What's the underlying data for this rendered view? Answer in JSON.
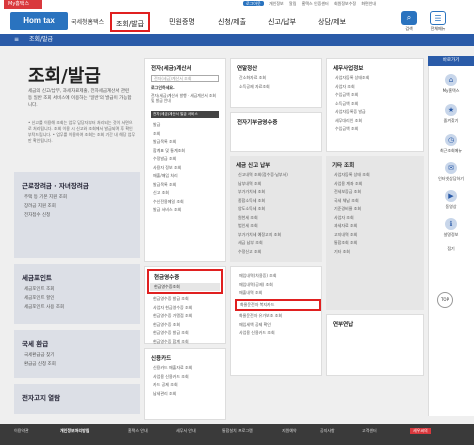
{
  "header": {
    "my_tab": "My홈택스",
    "logo": "Hom tax",
    "logo_sub": "국세청홈택스",
    "util": [
      "로그아웃",
      "개인정보",
      "알림",
      "홈택스 인증센터",
      "회원정보수정",
      "화면안내"
    ],
    "nav": [
      "조회/발급",
      "민원증명",
      "신청/제출",
      "신고/납부",
      "상담/제보"
    ],
    "search_label": "검색",
    "menu_label": "전체메뉴"
  },
  "bar": {
    "label": "조회/발급"
  },
  "intro": {
    "title": "조회/발급",
    "text": "세금의 신고/납부, 과세자료제출, 전자세금계산서 관련 등 일반 조회 서비스에 이용하는 '일반'의 발급이 가능합니다.",
    "notes": "• 신고를 이용해 조회는 업무 담당자부터 처리되는 것이 서면으로 처리됩니다. 조회 이용 시 신고와 조회에서 발급되며 후 확인 부탁드립니다. • 업무를 이용하여 조회는 조회 기간 내 해당 업무만 확인됩니다."
  },
  "left_boxes": [
    {
      "title": "근로장려금 · 자녀장려금",
      "items": [
        "주택 등 기본 지원 조회",
        "장려금 지원 조회",
        "전자접수 신청"
      ]
    },
    {
      "title": "세금포인트",
      "items": [
        "세금포인트 조회",
        "세금포인트 할인",
        "세금포인트 사용 조회"
      ]
    },
    {
      "title": "국세 환급",
      "items": [
        "국세환급금 찾기",
        "환급금 신청 조회"
      ]
    },
    {
      "title": "전자고지 열람",
      "items": []
    }
  ],
  "panels": {
    "etax": {
      "title": "전자(세금)계산서",
      "search_placeholder": "전자(세금)계산서 조회",
      "login_hint": "로그인하세요.",
      "box_text": "전자(세금)계산서 발행 · 세금계산서 조회 및 발급 안내",
      "box_btn": "전자(세금)계산서 발급 서비스",
      "items": [
        "발급",
        "조회",
        "발급목록 조회",
        "합계표 및 통계조회",
        "수정발급 조회",
        "사용자 정보 조회",
        "매출/매입 처리",
        "발급목록 조회",
        "신고 조회",
        "수신전용메일 조회",
        "발급 서비스 조회"
      ]
    },
    "year_end": {
      "title": "연말정산",
      "items": [
        "간소화자료 조회",
        "소득공제 자료조회"
      ]
    },
    "pension": {
      "title": "전자기부금영수증",
      "items": []
    },
    "biz_info": {
      "title": "세무사업정보",
      "items": [
        "사업자등록 상태조회",
        "사업자 조회",
        "수입금액 조회",
        "소득금액 조회",
        "사업자등록증 발급",
        "세무대리인 조회",
        "수입금액 조회"
      ]
    },
    "tax_report": {
      "title": "세금 신고 납부",
      "items": [
        "신고내역 조회(접수증·납부서)",
        "납부내역 조회",
        "부가가치세 조회",
        "종합소득세 조회",
        "양도소득세 조회",
        "원천세 조회",
        "법인세 조회",
        "부가가치세 예정고지 조회",
        "세금 납부 조회",
        "수정신고 조회"
      ]
    },
    "etc_query": {
      "title": "기타 조회",
      "items": [
        "사업자등록 상태 조회",
        "사업용 계좌 조회",
        "전세보증금 조회",
        "국세 체납 조회",
        "기준경비율 조회",
        "사업자 조회",
        "과세자료 조회",
        "고지내역 조회",
        "통합조회 조회",
        "기타 조회"
      ]
    },
    "cash_receipt": {
      "title": "현금영수증",
      "sub": "현금영수증조회",
      "items": [
        "현금영수증 발급 조회",
        "사업자 현금영수증 조회",
        "현금영수증 가맹점 조회",
        "현금영수증 조회",
        "현금영수증 발급 조회",
        "현금영수증 합계 조회"
      ]
    },
    "card_sales": {
      "title": "",
      "items": [
        "매입내역(차용증) 조회",
        "매입내역(공제) 조회",
        "매출내역 조회",
        "화물운전자 복지카드",
        "화물운전자 유가보조 조회",
        "매입세액 공제 확인",
        "사업용 신용카드 조회"
      ]
    },
    "credit_card": {
      "title": "신용카드",
      "items": [
        "신용카드 매출자료 조회",
        "사업용 신용카드 조회",
        "카드 공제 조회",
        "납세관리 조회"
      ]
    },
    "annual": {
      "title": "연부연납",
      "items": []
    }
  },
  "sidebar": {
    "head": "바로가기",
    "items": [
      "My홈택스",
      "즐겨찾기",
      "최근조회메뉴",
      "인터넷상담하기",
      "동영상",
      "설명정보"
    ],
    "collapse": "접기",
    "top": "TOP"
  },
  "footer": [
    "이용약관",
    "개인정보처리방침",
    "홈택스 안내",
    "세무서 안내",
    "통합설치 프로그램",
    "지원예약",
    "공지사항",
    "고객센터",
    "세우씨의"
  ]
}
